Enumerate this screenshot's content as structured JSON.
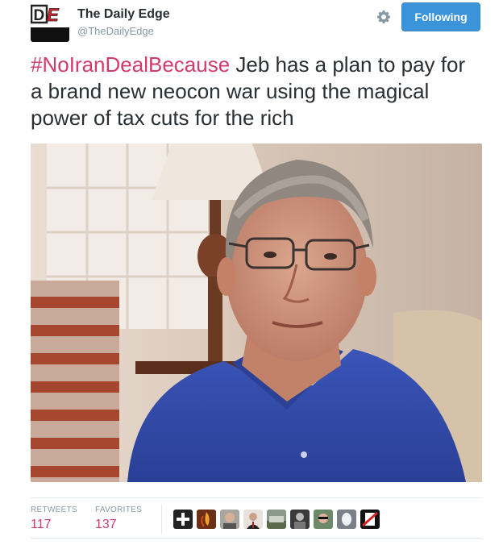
{
  "account": {
    "display_name": "The Daily Edge",
    "handle": "@TheDailyEdge",
    "avatar_letters": "DE"
  },
  "actions": {
    "follow_label": "Following"
  },
  "tweet": {
    "hashtag": "#NoIranDealBecause",
    "body": " Jeb has a plan to pay for a brand new neocon war using the magical power of tax cuts for the rich"
  },
  "stats": {
    "retweets_label": "RETWEETS",
    "retweets_count": "117",
    "favorites_label": "FAVORITES",
    "favorites_count": "137"
  },
  "icons": {
    "settings": "gear-icon",
    "more": "plus-icon"
  },
  "colors": {
    "accent": "#3b94d9",
    "hashtag": "#d13b6f",
    "muted": "#8899a6",
    "text": "#292f33"
  }
}
